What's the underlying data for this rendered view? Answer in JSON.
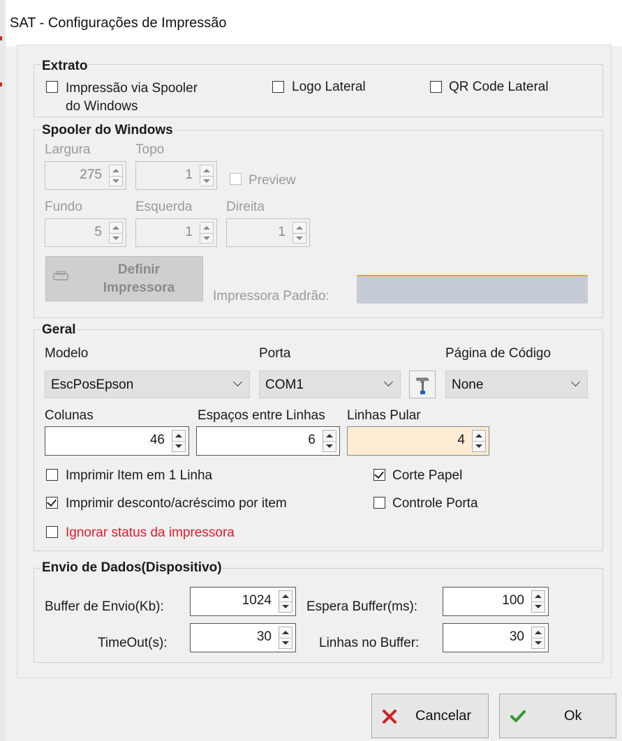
{
  "window": {
    "title": "SAT - Configurações de Impressão"
  },
  "extrato": {
    "label": "Extrato",
    "spooler_line1": "Impressão via Spooler",
    "spooler_line2": "do Windows",
    "logo_lateral": "Logo Lateral",
    "qr_lateral": "QR Code Lateral",
    "spooler_checked": false,
    "logo_checked": false,
    "qr_checked": false
  },
  "spooler": {
    "label": "Spooler do Windows",
    "largura_label": "Largura",
    "largura": "275",
    "topo_label": "Topo",
    "topo": "1",
    "preview_label": "Preview",
    "fundo_label": "Fundo",
    "fundo": "5",
    "esquerda_label": "Esquerda",
    "esquerda": "1",
    "direita_label": "Direita",
    "direita": "1",
    "definir_line1": "Definir",
    "definir_line2": "Impressora",
    "padrao_label": "Impressora Padrão:"
  },
  "geral": {
    "label": "Geral",
    "modelo_label": "Modelo",
    "modelo": "EscPosEpson",
    "porta_label": "Porta",
    "porta": "COM1",
    "pagina_label": "Página de Código",
    "pagina": "None",
    "colunas_label": "Colunas",
    "colunas": "46",
    "espacos_label": "Espaços entre Linhas",
    "espacos": "6",
    "linhas_pular_label": "Linhas Pular",
    "linhas_pular": "4",
    "item_1_linha": "Imprimir Item em 1 Linha",
    "desconto": "Imprimir desconto/acréscimo por item",
    "ignorar_status": "Ignorar status da impressora",
    "corte_papel": "Corte Papel",
    "controle_porta": "Controle Porta",
    "ignorar_color": "#e8192c"
  },
  "envio": {
    "label": "Envio de Dados(Dispositivo)",
    "buffer_label": "Buffer de Envio(Kb):",
    "buffer": "1024",
    "espera_label": "Espera Buffer(ms):",
    "espera": "100",
    "timeout_label": "TimeOut(s):",
    "timeout": "30",
    "linhas_buffer_label": "Linhas no Buffer:",
    "linhas_buffer": "30"
  },
  "buttons": {
    "cancel": "Cancelar",
    "ok": "Ok",
    "cancel_color": "#d11f1f",
    "ok_color": "#2f9a2f"
  }
}
